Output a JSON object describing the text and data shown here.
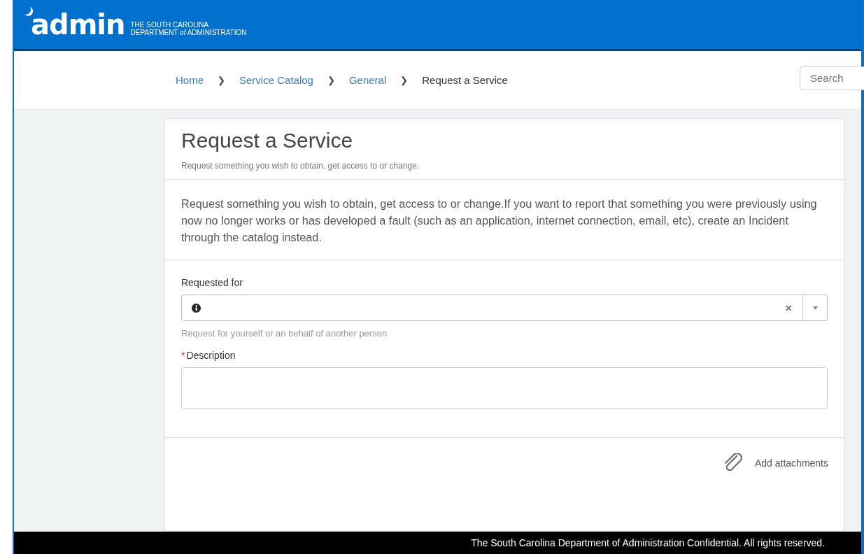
{
  "header": {
    "logo": "admin",
    "org_line_1": "THE SOUTH CAROLINA",
    "org_line_2": "DEPARTMENT *of* ADMINISTRATION"
  },
  "breadcrumb": [
    {
      "label": "Home",
      "link": true
    },
    {
      "label": "Service Catalog",
      "link": true
    },
    {
      "label": "General",
      "link": true
    },
    {
      "label": "Request a Service",
      "link": false
    }
  ],
  "breadcrumb_separator": "❯",
  "search": {
    "placeholder": "Search"
  },
  "card": {
    "title": "Request a Service",
    "subtitle": "Request something you wish to obtain, get access to or change.",
    "description": "Request something you wish to obtain, get access to or change.If you want to report that something you were previously using now no longer works or has developed a fault (such as an application, internet connection, email, etc), create an Incident through the catalog instead.",
    "fields": [
      {
        "kind": "reference",
        "label": "Requested for",
        "required": false,
        "clear": "×",
        "help": "Request for yourself or an behalf of another person"
      },
      {
        "kind": "textarea",
        "label": "Description",
        "required": true
      }
    ],
    "required_mark": "*",
    "attachments": "Add attachments"
  },
  "footer": "The South Carolina Department of Administration Confidential. All rights reserved."
}
